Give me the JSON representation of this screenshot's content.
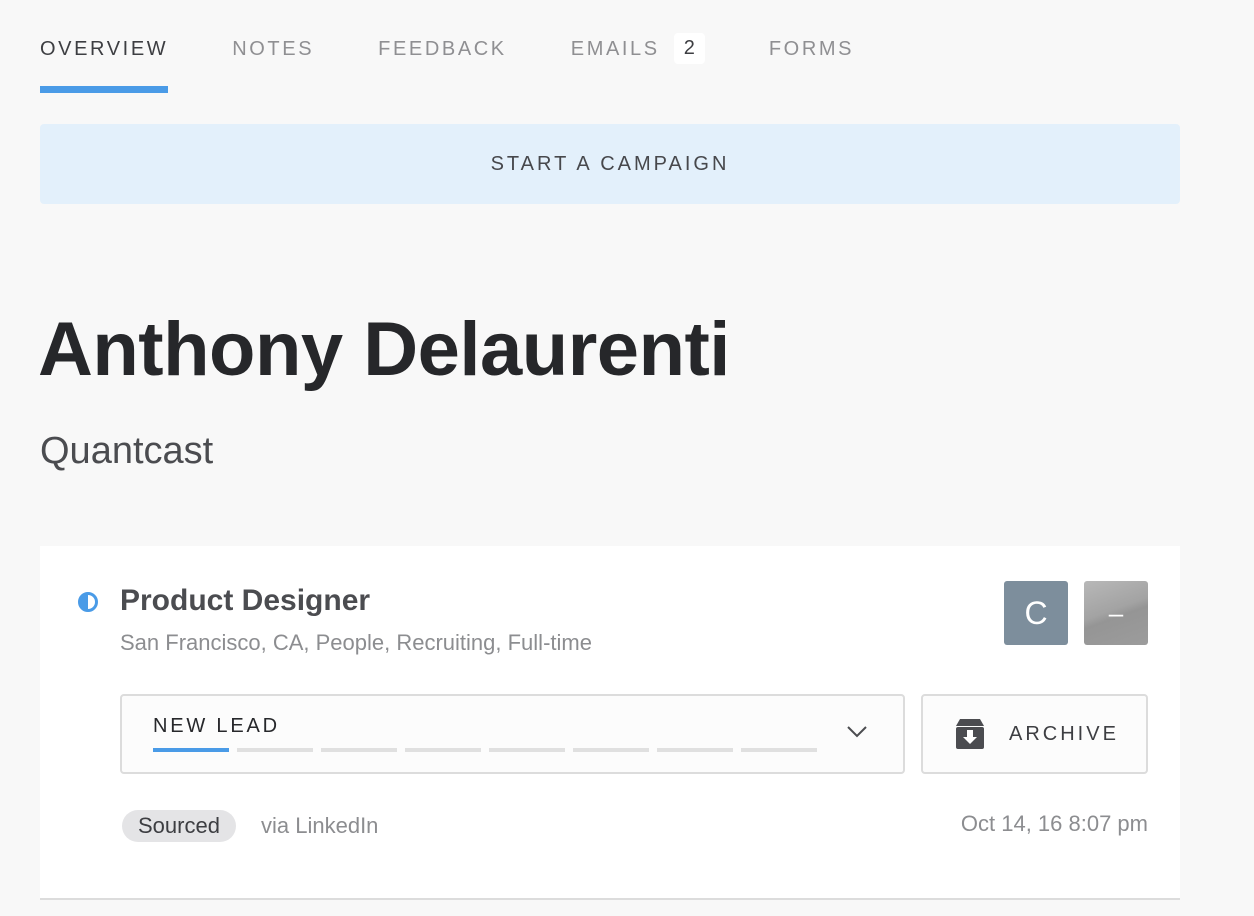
{
  "tabs": [
    {
      "label": "OVERVIEW",
      "active": true
    },
    {
      "label": "NOTES"
    },
    {
      "label": "FEEDBACK"
    },
    {
      "label": "EMAILS",
      "count": "2"
    },
    {
      "label": "FORMS"
    }
  ],
  "campaign_button": "START A CAMPAIGN",
  "contact": {
    "name": "Anthony Delaurenti",
    "company": "Quantcast"
  },
  "opportunity": {
    "status_icon": "half-circle-status-icon",
    "role": "Product Designer",
    "meta": "San Francisco, CA, People, Recruiting, Full-time",
    "owners": [
      {
        "initial": "C",
        "color": "#7d8e9c"
      },
      {
        "initial": "–",
        "color": "#a3a3a3"
      }
    ],
    "stage": {
      "label": "NEW LEAD",
      "current_step": 1,
      "total_steps": 8,
      "dropdown_icon": "chevron-down-icon"
    },
    "archive": {
      "label": "ARCHIVE",
      "icon": "archive-box-icon"
    },
    "source_badge": "Sourced",
    "source_via": "via LinkedIn",
    "timestamp": "Oct 14, 16 8:07 pm"
  },
  "colors": {
    "accent": "#4a9be7",
    "campaign_bg": "#e3f0fb",
    "background": "#f8f8f8"
  }
}
